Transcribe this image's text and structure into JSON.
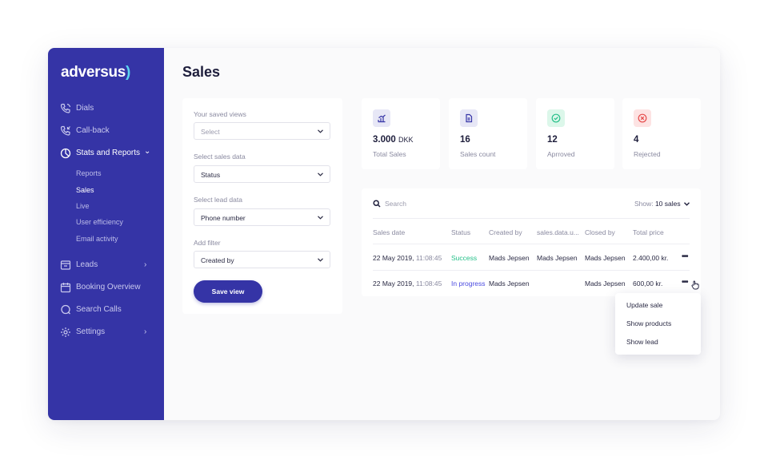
{
  "app": {
    "logo_text": "adversus",
    "logo_paren": ")"
  },
  "colors": {
    "brand": "#3534a6",
    "success": "#27c08a",
    "progress": "#4a4ae0",
    "approved_bg": "#dcf7ea",
    "rejected_bg": "#fde3e3",
    "neutral_icon_bg": "#e7e7f6"
  },
  "sidebar": {
    "items": [
      {
        "label": "Dials",
        "icon": "phone-icon"
      },
      {
        "label": "Call-back",
        "icon": "phone-callback-icon"
      },
      {
        "label": "Stats and Reports",
        "icon": "pie-chart-icon",
        "chevron": "⌄"
      },
      {
        "label": "Leads",
        "icon": "inbox-icon",
        "chevron": "›"
      },
      {
        "label": "Booking Overview",
        "icon": "calendar-icon"
      },
      {
        "label": "Search Calls",
        "icon": "search-calls-icon"
      },
      {
        "label": "Settings",
        "icon": "gear-icon",
        "chevron": "›"
      }
    ],
    "subitems": [
      {
        "label": "Reports"
      },
      {
        "label": "Sales"
      },
      {
        "label": "Live"
      },
      {
        "label": "User efficiency"
      },
      {
        "label": "Email activity"
      }
    ]
  },
  "page": {
    "title": "Sales"
  },
  "filters": {
    "saved_views_label": "Your saved views",
    "saved_views_value": "Select",
    "sales_data_label": "Select sales data",
    "sales_data_value": "Status",
    "lead_data_label": "Select lead data",
    "lead_data_value": "Phone number",
    "add_filter_label": "Add filter",
    "add_filter_value": "Created by",
    "save_button": "Save view"
  },
  "stats": [
    {
      "value": "3.000",
      "unit": "DKK",
      "label": "Total Sales",
      "icon": "chart-icon"
    },
    {
      "value": "16",
      "unit": "",
      "label": "Sales count",
      "icon": "document-icon"
    },
    {
      "value": "12",
      "unit": "",
      "label": "Aprroved",
      "icon": "check-circle-icon"
    },
    {
      "value": "4",
      "unit": "",
      "label": "Rejected",
      "icon": "x-circle-icon"
    }
  ],
  "table": {
    "search_placeholder": "Search",
    "show_label": "Show:",
    "show_value": "10 sales",
    "columns": [
      "Sales date",
      "Status",
      "Created by",
      "sales.data.u...",
      "Closed by",
      "Total price"
    ],
    "rows": [
      {
        "date": "22 May 2019,",
        "time": "11:08:45",
        "status": "Success",
        "created_by": "Mads Jepsen",
        "data_u": "Mads Jepsen",
        "closed_by": "Mads Jepsen",
        "total": "2.400,00 kr."
      },
      {
        "date": "22 May 2019,",
        "time": "11:08:45",
        "status": "In progress",
        "created_by": "Mads Jepsen",
        "data_u": "",
        "closed_by": "Mads Jepsen",
        "total": "600,00 kr."
      }
    ],
    "row_menu_glyph": "•••"
  },
  "context_menu": {
    "items": [
      "Update sale",
      "Show products",
      "Show lead"
    ]
  }
}
